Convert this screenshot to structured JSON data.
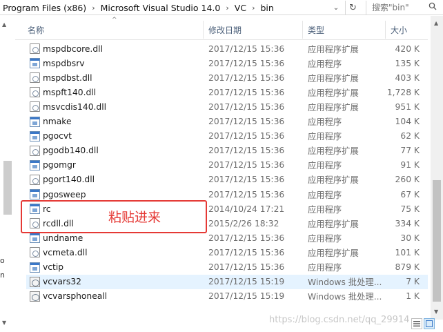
{
  "address": {
    "crumbs": [
      "Program Files (x86)",
      "Microsoft Visual Studio 14.0",
      "VC",
      "bin"
    ],
    "separator": "›",
    "dropdown": "⌄",
    "refresh": "↻"
  },
  "search": {
    "placeholder": "搜索\"bin\"",
    "icon": "search-icon"
  },
  "columns": {
    "name": "名称",
    "modified": "修改日期",
    "type": "类型",
    "size": "大小",
    "sort_indicator": "^"
  },
  "files": [
    {
      "name": "mspdbcore.dll",
      "date": "2017/12/15 15:36",
      "type": "应用程序扩展",
      "size": "420 K",
      "icon": "dll-icon"
    },
    {
      "name": "mspdbsrv",
      "date": "2017/12/15 15:36",
      "type": "应用程序",
      "size": "135 K",
      "icon": "exe-icon"
    },
    {
      "name": "mspdbst.dll",
      "date": "2017/12/15 15:36",
      "type": "应用程序扩展",
      "size": "403 K",
      "icon": "dll-icon"
    },
    {
      "name": "mspft140.dll",
      "date": "2017/12/15 15:36",
      "type": "应用程序扩展",
      "size": "1,728 K",
      "icon": "dll-icon"
    },
    {
      "name": "msvcdis140.dll",
      "date": "2017/12/15 15:36",
      "type": "应用程序扩展",
      "size": "951 K",
      "icon": "dll-icon"
    },
    {
      "name": "nmake",
      "date": "2017/12/15 15:36",
      "type": "应用程序",
      "size": "104 K",
      "icon": "exe-icon"
    },
    {
      "name": "pgocvt",
      "date": "2017/12/15 15:36",
      "type": "应用程序",
      "size": "62 K",
      "icon": "exe-icon"
    },
    {
      "name": "pgodb140.dll",
      "date": "2017/12/15 15:36",
      "type": "应用程序扩展",
      "size": "77 K",
      "icon": "dll-icon"
    },
    {
      "name": "pgomgr",
      "date": "2017/12/15 15:36",
      "type": "应用程序",
      "size": "91 K",
      "icon": "exe-icon"
    },
    {
      "name": "pgort140.dll",
      "date": "2017/12/15 15:36",
      "type": "应用程序扩展",
      "size": "260 K",
      "icon": "dll-icon"
    },
    {
      "name": "pgosweep",
      "date": "2017/12/15 15:36",
      "type": "应用程序",
      "size": "67 K",
      "icon": "exe-icon"
    },
    {
      "name": "rc",
      "date": "2014/10/24 17:21",
      "type": "应用程序",
      "size": "75 K",
      "icon": "exe-icon"
    },
    {
      "name": "rcdll.dll",
      "date": "2015/2/26 18:32",
      "type": "应用程序扩展",
      "size": "334 K",
      "icon": "dll-icon"
    },
    {
      "name": "undname",
      "date": "2017/12/15 15:36",
      "type": "应用程序",
      "size": "30 K",
      "icon": "exe-icon"
    },
    {
      "name": "vcmeta.dll",
      "date": "2017/12/15 15:36",
      "type": "应用程序扩展",
      "size": "101 K",
      "icon": "dll-icon"
    },
    {
      "name": "vctip",
      "date": "2017/12/15 15:36",
      "type": "应用程序",
      "size": "879 K",
      "icon": "exe-icon"
    },
    {
      "name": "vcvars32",
      "date": "2017/12/15 15:19",
      "type": "Windows 批处理...",
      "size": "7 K",
      "icon": "bat-icon",
      "selected": true
    },
    {
      "name": "vcvarsphoneall",
      "date": "2017/12/15 15:19",
      "type": "Windows 批处理...",
      "size": "1 K",
      "icon": "bat-icon"
    }
  ],
  "annotation": {
    "text": "粘贴进来",
    "color": "#e53935"
  },
  "watermark": "https://blog.csdn.net/qq_29914",
  "side_glyphs": [
    "o",
    "n"
  ],
  "scroll": {
    "up": "▲",
    "down": "▼"
  },
  "colors": {
    "selected_row": "#e5f3ff",
    "header_text": "#4c607a",
    "annotation": "#e53935"
  }
}
